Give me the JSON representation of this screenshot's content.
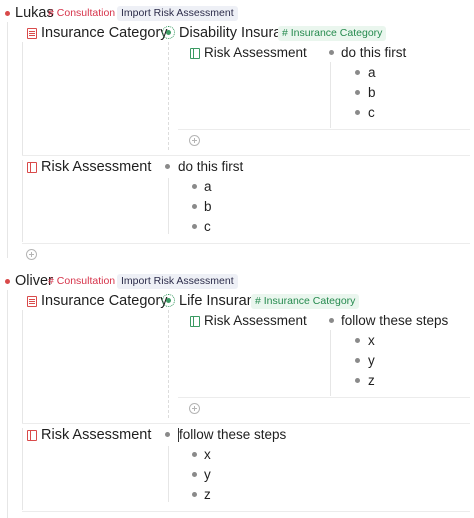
{
  "nodes": [
    {
      "name": "Lukas",
      "tag": "Consultation",
      "button": "Import Risk Assessment",
      "category_label": "Insurance Category",
      "category_value": "Disability Insurance",
      "category_tag": "Insurance Category",
      "nested_risk_label": "Risk Assessment",
      "nested_items": [
        "do this first",
        "a",
        "b",
        "c"
      ],
      "risk_label": "Risk Assessment",
      "risk_items": [
        "do this first",
        "a",
        "b",
        "c"
      ]
    },
    {
      "name": "Oliver",
      "tag": "Consultation",
      "button": "Import Risk Assessment",
      "category_label": "Insurance Category",
      "category_value": "Life Insurance",
      "category_tag": "Insurance Category",
      "nested_risk_label": "Risk Assessment",
      "nested_items": [
        "follow these steps",
        "x",
        "y",
        "z"
      ],
      "risk_label": "Risk Assessment",
      "risk_items": [
        "follow these steps",
        "x",
        "y",
        "z"
      ]
    }
  ],
  "colors": {
    "tag_red": "#d6334a",
    "tag_green": "#258a4e",
    "bullet": "#8a8a8a"
  },
  "icons": [
    "bullet-dot",
    "doc-icon",
    "panel-icon",
    "gear-icon",
    "add-circle-icon"
  ]
}
